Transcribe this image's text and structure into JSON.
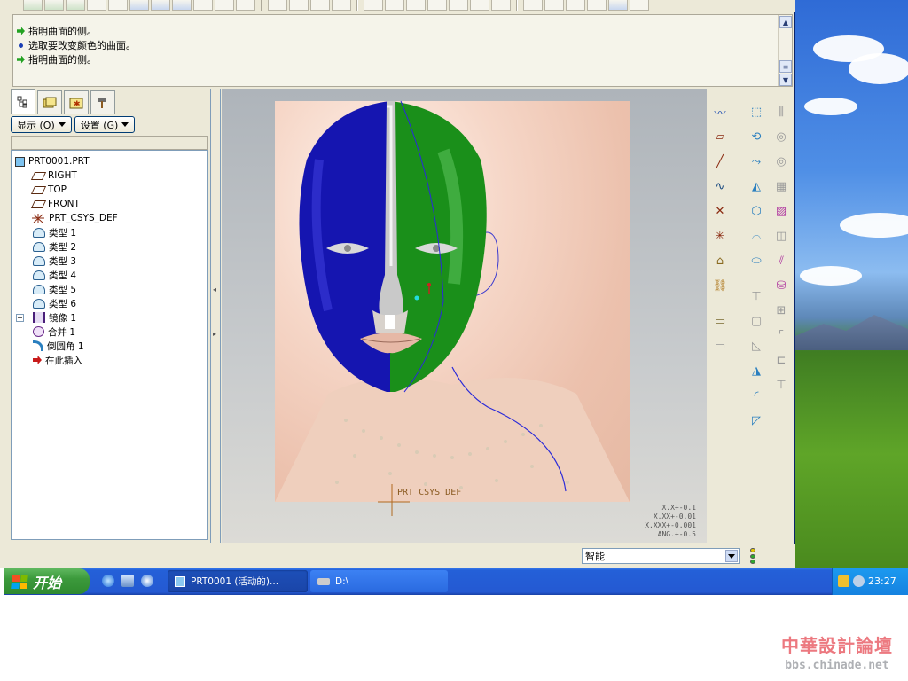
{
  "messages": [
    {
      "icon": "green-arrow-icon",
      "text": "指明曲面的侧。"
    },
    {
      "icon": "blue-bullet-icon",
      "text": "选取要改变颜色的曲面。"
    },
    {
      "icon": "green-arrow-icon",
      "text": "指明曲面的侧。"
    }
  ],
  "nav_tabs": [
    "model-tree-tab",
    "layer-tab",
    "favorites-tab",
    "tools-tab"
  ],
  "tree_buttons": {
    "show": "显示 (O)",
    "settings": "设置 (G)"
  },
  "model_tree": [
    {
      "label": "PRT0001.PRT",
      "icon": "part-icon",
      "level": 0
    },
    {
      "label": "RIGHT",
      "icon": "datum-plane-icon",
      "level": 1
    },
    {
      "label": "TOP",
      "icon": "datum-plane-icon",
      "level": 1
    },
    {
      "label": "FRONT",
      "icon": "datum-plane-icon",
      "level": 1
    },
    {
      "label": "PRT_CSYS_DEF",
      "icon": "csys-icon",
      "level": 1
    },
    {
      "label": "类型 1",
      "icon": "surface-icon",
      "level": 1
    },
    {
      "label": "类型 2",
      "icon": "surface-icon",
      "level": 1
    },
    {
      "label": "类型 3",
      "icon": "surface-icon",
      "level": 1
    },
    {
      "label": "类型 4",
      "icon": "surface-icon",
      "level": 1
    },
    {
      "label": "类型 5",
      "icon": "surface-icon",
      "level": 1
    },
    {
      "label": "类型 6",
      "icon": "surface-icon",
      "level": 1
    },
    {
      "label": "镜像 1",
      "icon": "mirror-icon",
      "level": 1,
      "expandable": true
    },
    {
      "label": "合并 1",
      "icon": "merge-icon",
      "level": 1
    },
    {
      "label": "倒圆角 1",
      "icon": "round-icon",
      "level": 1
    },
    {
      "label": "在此插入",
      "icon": "insert-here-icon",
      "level": 1
    }
  ],
  "viewport": {
    "csys_label": "PRT_CSYS_DEF",
    "tolerances": [
      "X.X+-0.1",
      "X.XX+-0.01",
      "X.XXX+-0.001",
      "ANG.+-0.5"
    ],
    "surface_colors": {
      "left_half": "#1515b0",
      "right_half": "#1a8f1a"
    }
  },
  "status": {
    "filter_value": "智能"
  },
  "taskbar": {
    "start_label": "开始",
    "tasks": [
      {
        "label": "PRT0001 (活动的)...",
        "active": true
      },
      {
        "label": "D:\\",
        "active": false
      }
    ],
    "clock": "23:27"
  },
  "watermark": {
    "title": "中華設計論壇",
    "url": "bbs.chinade.net"
  }
}
